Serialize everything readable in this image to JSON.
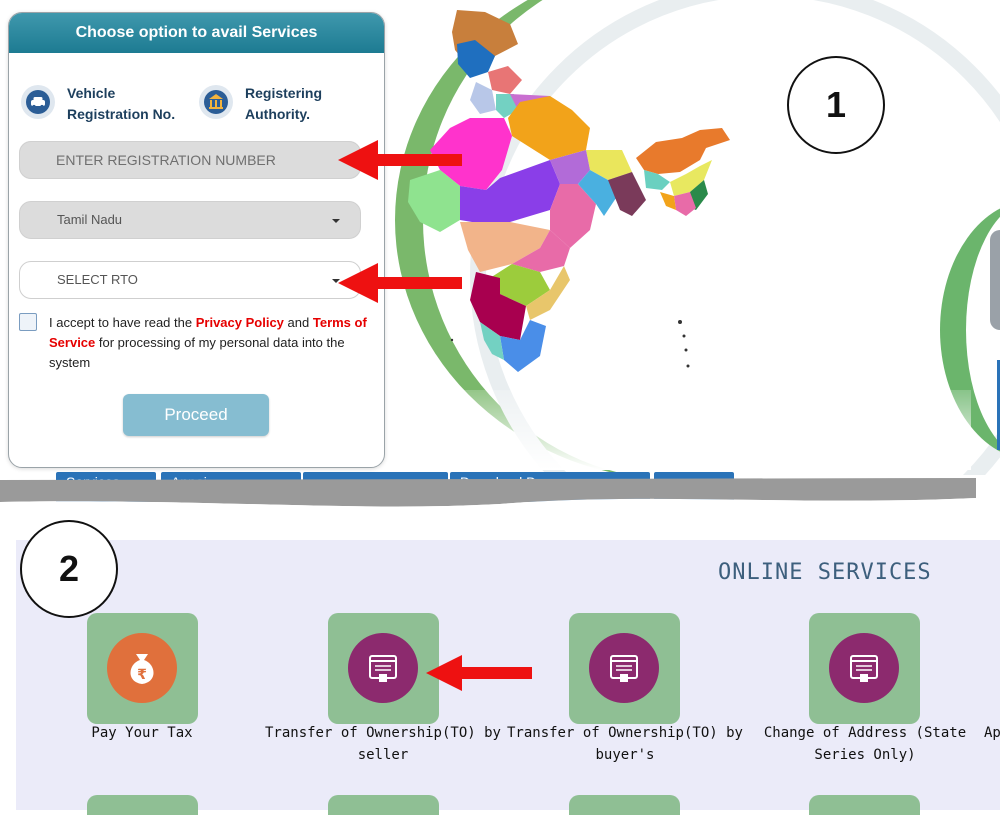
{
  "card": {
    "title": "Choose option to avail Services",
    "option_vehicle": "Vehicle Registration No.",
    "option_authority": "Registering Authority.",
    "reg_placeholder": "ENTER REGISTRATION NUMBER",
    "state_selected": "Tamil Nadu",
    "rto_selected": "SELECT RTO",
    "consent_prefix": "I accept to have read the",
    "privacy_link": "Privacy Policy",
    "and": "and",
    "terms_link": "Terms of Service",
    "consent_suffix": "for processing of my personal data into the system",
    "proceed": "Proceed"
  },
  "annotations": {
    "step1": "1",
    "step2": "2"
  },
  "menu": [
    "Services",
    "Appoi",
    "Download D"
  ],
  "online": {
    "title": "ONLINE SERVICES",
    "services": [
      {
        "label": "Pay Your Tax",
        "icon": "rupee-bag-icon"
      },
      {
        "label": "Transfer of Ownership(TO) by seller",
        "icon": "web-form-icon"
      },
      {
        "label": "Transfer of Ownership(TO) by buyer's",
        "icon": "web-form-icon"
      },
      {
        "label": "Change of Address (State Series Only)",
        "icon": "web-form-icon"
      },
      {
        "label": "Ap",
        "icon": ""
      }
    ]
  },
  "colors": {
    "header": "#1d7b92",
    "tile": "#8fbf94",
    "link": "#e60000",
    "arrow": "#ee1111",
    "button": "#86bdd1"
  }
}
